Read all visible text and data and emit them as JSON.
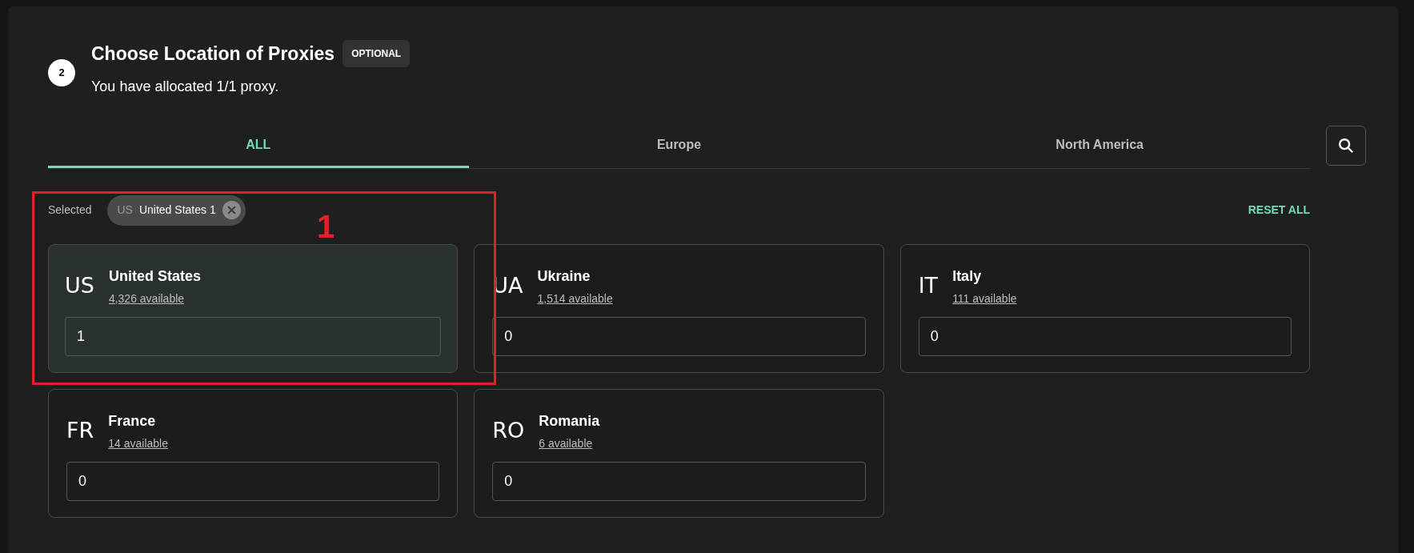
{
  "step": {
    "number": "2",
    "title": "Choose Location of Proxies",
    "badge": "OPTIONAL",
    "subtitle": "You have allocated 1/1 proxy."
  },
  "tabs": [
    {
      "label": "ALL",
      "selected": true
    },
    {
      "label": "Europe",
      "selected": false
    },
    {
      "label": "North America",
      "selected": false
    }
  ],
  "selected_label": "Selected",
  "chips": [
    {
      "code": "US",
      "label": "United States 1"
    }
  ],
  "reset_label": "RESET ALL",
  "annotation": {
    "label": "1"
  },
  "countries": [
    {
      "code": "US",
      "name": "United States",
      "available": "4,326 available",
      "value": "1",
      "selected": true
    },
    {
      "code": "UA",
      "name": "Ukraine",
      "available": "1,514 available",
      "value": "0",
      "selected": false
    },
    {
      "code": "IT",
      "name": "Italy",
      "available": "111 available",
      "value": "0",
      "selected": false
    },
    {
      "code": "FR",
      "name": "France",
      "available": "14 available",
      "value": "0",
      "selected": false
    },
    {
      "code": "RO",
      "name": "Romania",
      "available": "6 available",
      "value": "0",
      "selected": false
    }
  ]
}
